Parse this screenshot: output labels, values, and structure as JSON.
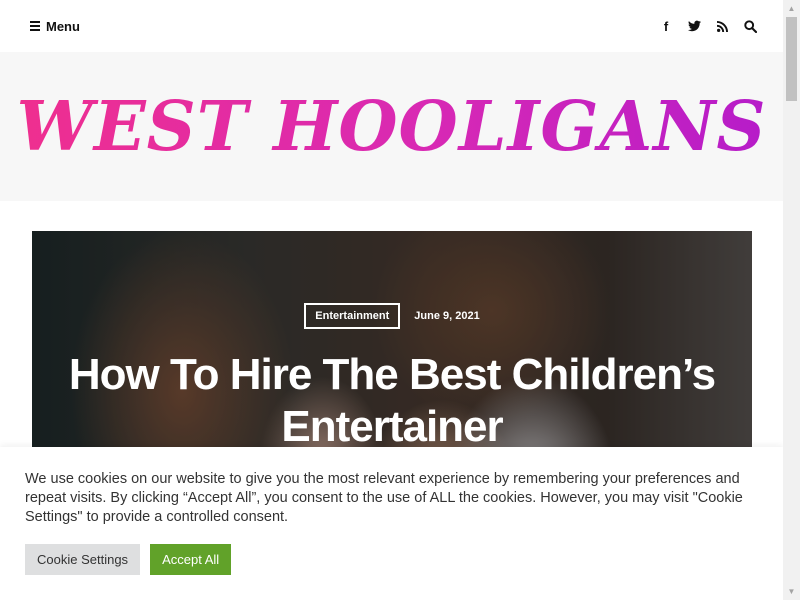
{
  "topbar": {
    "menu_label": "Menu",
    "social": [
      {
        "icon": "facebook-icon",
        "glyph": "f"
      },
      {
        "icon": "twitter-icon",
        "glyph": "🐦"
      },
      {
        "icon": "rss-icon",
        "glyph": "◉"
      },
      {
        "icon": "search-icon",
        "glyph": "⌕"
      }
    ]
  },
  "header": {
    "site_title": "WEST HOOLIGANS",
    "title_colors": [
      "#ef2f8f",
      "#d829b4",
      "#b61cc9"
    ]
  },
  "featured": {
    "category": "Entertainment",
    "date": "June 9, 2021",
    "title": "How To Hire The Best Children’s Entertainer"
  },
  "cookie": {
    "text": "We use cookies on our website to give you the most relevant experience by remembering your preferences and repeat visits. By clicking “Accept All”, you consent to the use of ALL the cookies. However, you may visit \"Cookie Settings\" to provide a controlled consent.",
    "settings_label": "Cookie Settings",
    "accept_label": "Accept All",
    "accept_color": "#61a229"
  }
}
